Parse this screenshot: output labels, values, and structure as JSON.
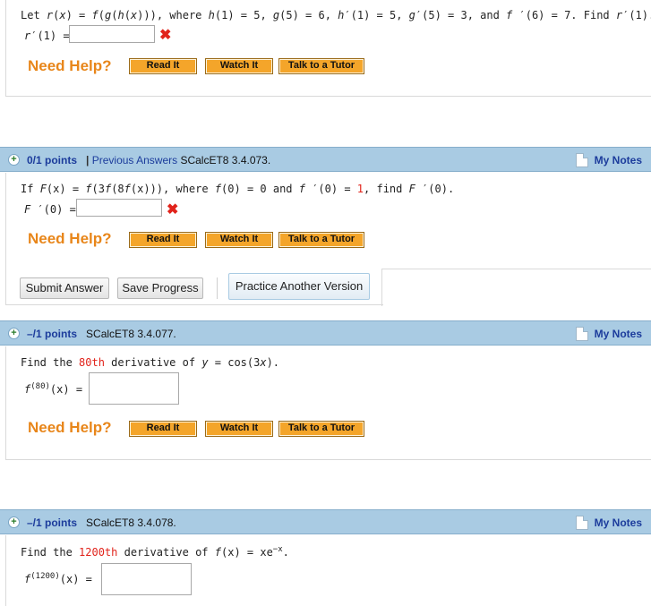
{
  "q1": {
    "prompt_parts": [
      "Let ",
      "r",
      "(",
      "x",
      ") = ",
      "f",
      "(",
      "g",
      "(",
      "h",
      "(",
      "x",
      "))), where ",
      "h",
      "(1) = 5, ",
      "g",
      "(5) = 6, ",
      "h",
      "′(1) = 5, ",
      "g",
      "′(5) = 3, and ",
      "f",
      " ′(6) = 7. Find ",
      "r",
      "′(1)."
    ],
    "answer_label_fn": "r",
    "answer_label_rest": "′(1) =",
    "answer_value": ""
  },
  "help": {
    "need_help": "Need Help?",
    "read_it": "Read It",
    "watch_it": "Watch It",
    "talk_to_tutor": "Talk to a Tutor"
  },
  "q2": {
    "points": "0/1 points",
    "separator": "|",
    "previous_answers": "Previous Answers",
    "id": "SCalcET8 3.4.073.",
    "my_notes": "My Notes",
    "prompt_a": "If ",
    "prompt_F": "F",
    "prompt_b": "(x) = ",
    "prompt_f1": "f",
    "prompt_c": "(3",
    "prompt_f2": "f",
    "prompt_d": "(8",
    "prompt_f3": "f",
    "prompt_e": "(x))), where ",
    "prompt_f4": "f",
    "prompt_g": "(0) = 0 and ",
    "prompt_f5": "f",
    "prompt_h": " ′(0) = ",
    "prompt_one": "1",
    "prompt_i": ", find ",
    "prompt_F2": "F",
    "prompt_j": " ′(0).",
    "answer_label_fn": "F",
    "answer_label_rest": " ′(0) =",
    "answer_value": "",
    "submit": "Submit Answer",
    "save": "Save Progress",
    "practice": "Practice Another Version"
  },
  "q3": {
    "points": "–/1 points",
    "id": "SCalcET8 3.4.077.",
    "my_notes": "My Notes",
    "prompt_a": "Find the ",
    "prompt_ord": "80th",
    "prompt_b": " derivative of ",
    "prompt_y": "y",
    "prompt_c": " = cos(3",
    "prompt_x": "x",
    "prompt_d": ").",
    "answer_fn": "f",
    "answer_sup": "(80)",
    "answer_rest": "(x) =",
    "answer_value": ""
  },
  "q4": {
    "points": "–/1 points",
    "id": "SCalcET8 3.4.078.",
    "my_notes": "My Notes",
    "prompt_a": "Find the ",
    "prompt_ord": "1200th",
    "prompt_b": " derivative of ",
    "prompt_f": "f",
    "prompt_c": "(x) = xe",
    "prompt_exp": "−x",
    "prompt_d": ".",
    "answer_fn": "f",
    "answer_sup": "(1200)",
    "answer_rest": "(x) =",
    "answer_value": ""
  },
  "colors": {
    "header_bg": "#a9cbe3",
    "link_blue": "#1c3c9c",
    "help_orange": "#e8861a",
    "button_orange": "#f4a52a",
    "error_red": "#e1231b"
  }
}
